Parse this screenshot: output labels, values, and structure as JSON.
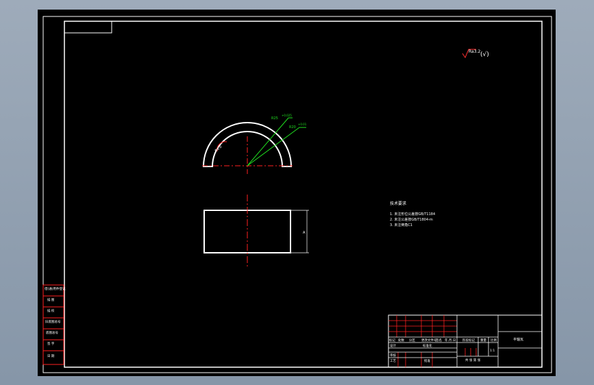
{
  "drawing": {
    "roughness": "Ra3.2",
    "roughness_other": "(√)",
    "dims": {
      "outer_dia": "R25",
      "outer_tol": "+0.025",
      "inner_dia": "R20",
      "inner_tol": "+0.01",
      "arc_radius": "R4.0",
      "width": "A"
    },
    "notes": {
      "title": "技术要求",
      "lines": [
        "1. 未注形位公差按GB/T1184",
        "2. 未注公差按GB/T1804-m",
        "3. 未注倒角C1"
      ]
    },
    "side_labels": [
      "借(通)用件登记",
      "描 图",
      "描 校",
      "旧底图总号",
      "底图总号",
      "签 字",
      "日 期"
    ],
    "title_block": {
      "row1": [
        "标记",
        "处数",
        "分区",
        "更改文件号",
        "签名",
        "年.月.日"
      ],
      "design": "设计",
      "standard": "标准化",
      "stage_mark": "阶段标记",
      "weight": "重量",
      "scale": "比例",
      "scale_value": "1:1",
      "review": "审核",
      "process": "工艺",
      "approve": "批准",
      "sheet": "共 张 第 张",
      "part_name": "半轴瓦"
    }
  }
}
